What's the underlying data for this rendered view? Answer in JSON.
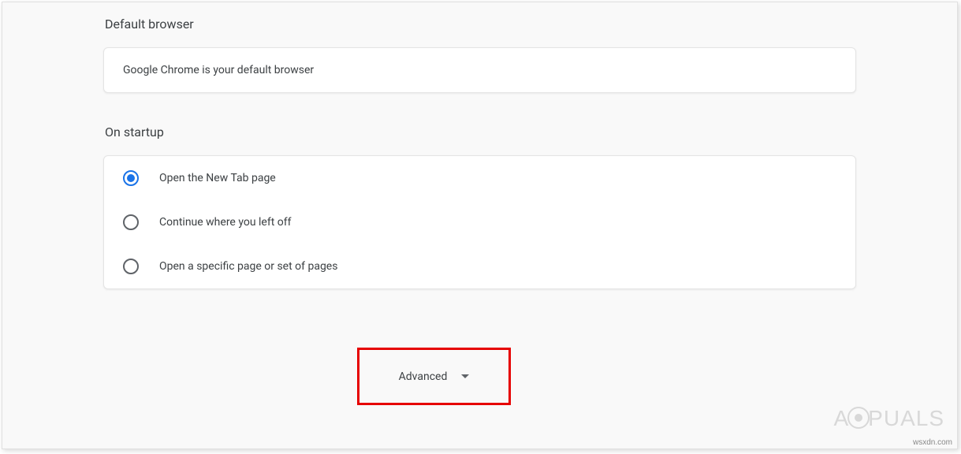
{
  "sections": {
    "default_browser": {
      "title": "Default browser",
      "status": "Google Chrome is your default browser"
    },
    "on_startup": {
      "title": "On startup",
      "options": [
        {
          "label": "Open the New Tab page",
          "selected": true
        },
        {
          "label": "Continue where you left off",
          "selected": false
        },
        {
          "label": "Open a specific page or set of pages",
          "selected": false
        }
      ]
    }
  },
  "advanced": {
    "label": "Advanced"
  },
  "watermark": {
    "prefix": "A",
    "suffix": "PUALS"
  },
  "footer_url": "wsxdn.com"
}
